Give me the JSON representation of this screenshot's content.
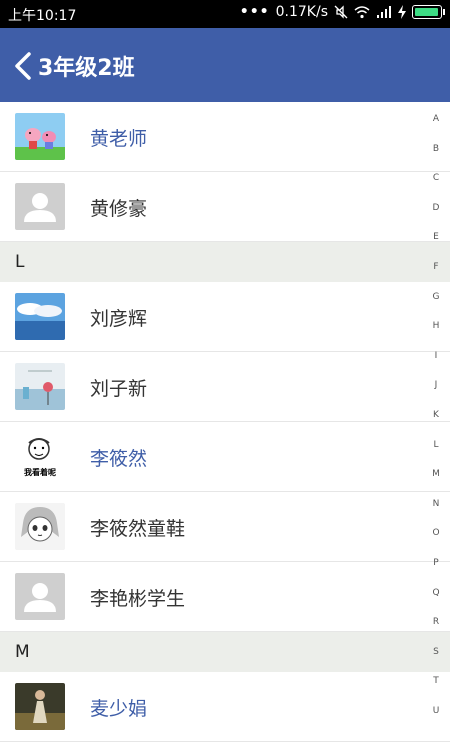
{
  "status_bar": {
    "time": "上午10:17",
    "dots": "•••",
    "speed": "0.17K/s",
    "icons": [
      "mute-icon",
      "wifi-icon",
      "signal-icon",
      "charging-icon",
      "battery-icon"
    ]
  },
  "header": {
    "title": "3年级2班",
    "back_icon": "chevron-left-icon",
    "bg_color": "#3f5ea8"
  },
  "contacts": {
    "row0": {
      "name": "黄老师",
      "avatar": "peppa-pig-photo"
    },
    "row1": {
      "name": "黄修豪",
      "avatar": "default-person-icon"
    },
    "sectionL": "L",
    "row2": {
      "name": "刘彦辉",
      "avatar": "sky-photo"
    },
    "row3": {
      "name": "刘子新",
      "avatar": "beach-photo"
    },
    "row4": {
      "name": "李筱然",
      "avatar": "meme-sketch",
      "caption": "我看着呢"
    },
    "row5": {
      "name": "李筱然童鞋",
      "avatar": "anime-sketch"
    },
    "row6": {
      "name": "李艳彬学生",
      "avatar": "default-person-icon"
    },
    "sectionM": "M",
    "row7": {
      "name": "麦少娟",
      "avatar": "person-photo"
    }
  },
  "index_letters": [
    "A",
    "B",
    "C",
    "D",
    "E",
    "F",
    "G",
    "H",
    "I",
    "J",
    "K",
    "L",
    "M",
    "N",
    "O",
    "P",
    "Q",
    "R",
    "S",
    "T",
    "U"
  ]
}
